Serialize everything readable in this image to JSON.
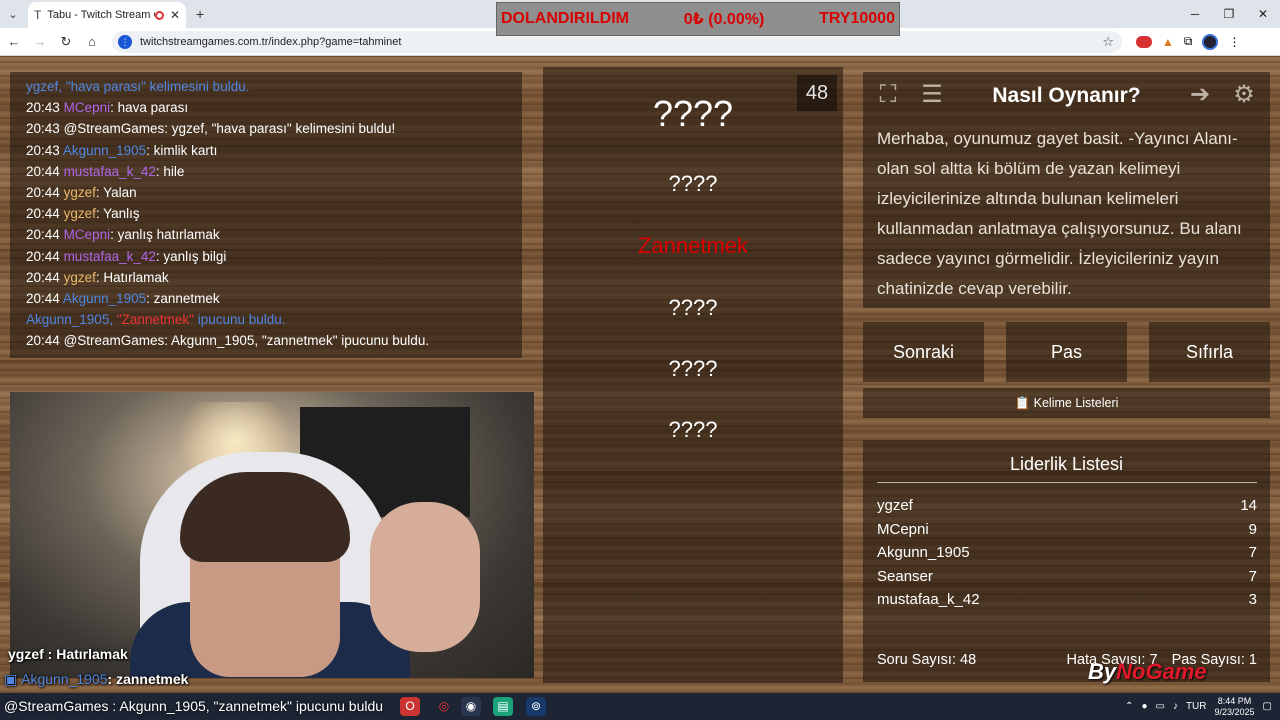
{
  "browser": {
    "tab_title": "Tabu - Twitch Stream Game",
    "url": "twitchstreamgames.com.tr/index.php?game=tahminet"
  },
  "ticker": {
    "left": "DOLANDIRILDIM",
    "center": "0₺ (0.00%)",
    "right": "TRY10000"
  },
  "chat": {
    "lines": [
      {
        "ts": "",
        "user": "ygzef",
        "text": ", \"hava parası\" kelimesini buldu.",
        "color": "#4f86e0"
      },
      {
        "ts": "20:43",
        "user": "MCepni",
        "text": ": hava parası",
        "color": "#b065e6"
      },
      {
        "ts": "20:43",
        "user": "@StreamGames",
        "text": ": ygzef, \"hava parası\" kelimesini buldu!",
        "color": "#ffffff"
      },
      {
        "ts": "20:43",
        "user": "Akgunn_1905",
        "text": ": kimlik kartı",
        "color": "#4f86e0"
      },
      {
        "ts": "20:44",
        "user": "mustafaa_k_42",
        "text": ": hile",
        "color": "#b065e6"
      },
      {
        "ts": "20:44",
        "user": "ygzef",
        "text": ": Yalan",
        "color": "#e9b86a"
      },
      {
        "ts": "20:44",
        "user": "ygzef",
        "text": ": Yanlış",
        "color": "#e9b86a"
      },
      {
        "ts": "20:44",
        "user": "MCepni",
        "text": ": yanlış hatırlamak",
        "color": "#b065e6"
      },
      {
        "ts": "20:44",
        "user": "mustafaa_k_42",
        "text": ": yanlış bilgi",
        "color": "#b065e6"
      },
      {
        "ts": "20:44",
        "user": "ygzef",
        "text": ": Hatırlamak",
        "color": "#e9b86a"
      },
      {
        "ts": "20:44",
        "user": "Akgunn_1905",
        "text": ": zannetmek",
        "color": "#4f86e0"
      },
      {
        "ts": "",
        "user": "Akgunn_1905, ",
        "text": "",
        "color": "#4f86e0",
        "hl": "\"Zannetmek\"",
        "tail": " ipucunu buldu."
      },
      {
        "ts": "20:44",
        "user": "@StreamGames",
        "text": ": Akgunn_1905, \"zannetmek\" ipucunu buldu.",
        "color": "#ffffff"
      }
    ]
  },
  "words": {
    "counter": "48",
    "items": [
      "????",
      "????",
      "Zannetmek",
      "????",
      "????",
      "????"
    ]
  },
  "howto": {
    "title": "Nasıl Oynanır?",
    "text": "Merhaba, oyunumuz gayet basit. -Yayıncı Alanı- olan sol altta ki bölüm de yazan kelimeyi izleyicilerinize altında bulunan kelimeleri kullanmadan anlatmaya çalışıyorsunuz. Bu alanı sadece yayıncı görmelidir. İzleyicileriniz yayın chatinizde cevap verebilir.",
    "icons": [
      "fullscreen-icon",
      "notes-icon",
      "logout-icon",
      "gear-icon"
    ]
  },
  "buttons": {
    "next": "Sonraki",
    "pass": "Pas",
    "reset": "Sıfırla",
    "lists": "Kelime Listeleri"
  },
  "leaderboard": {
    "title": "Liderlik Listesi",
    "rows": [
      {
        "name": "ygzef",
        "score": "14"
      },
      {
        "name": "MCepni",
        "score": "9"
      },
      {
        "name": "Akgunn_1905",
        "score": "7"
      },
      {
        "name": "Seanser",
        "score": "7"
      },
      {
        "name": "mustafaa_k_42",
        "score": "3"
      }
    ],
    "questions": "Soru Sayısı: 48",
    "errors": "Hata Sayısı: 7",
    "passes": "Pas Sayısı: 1"
  },
  "overlay": {
    "line1": "ygzef : Hatırlamak",
    "line2_user": "Akgunn_1905",
    "line2_text": ": zannetmek",
    "bottom": "@StreamGames : Akgunn_1905, \"zannetmek\" ipucunu buldu",
    "logo_a": "By",
    "logo_b": "NoGame"
  },
  "taskbar": {
    "lang": "TUR",
    "time": "8:44 PM",
    "date": "9/23/2025"
  },
  "colors": {
    "accent_red": "#d00000",
    "wood_dark": "#6b4a2e",
    "chat_blue": "#4f86e0",
    "chat_purple": "#b065e6"
  }
}
